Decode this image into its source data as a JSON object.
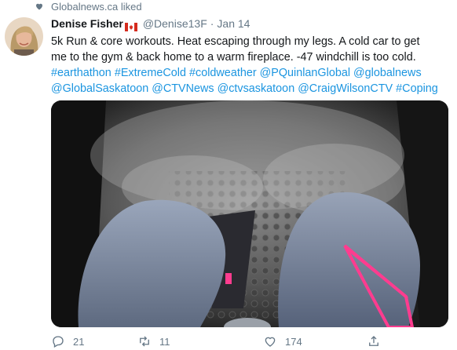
{
  "liked_by": {
    "text": "Globalnews.ca liked"
  },
  "tweet": {
    "display_name": "Denise Fisher",
    "flag_icon": "canada-flag-icon",
    "handle": "@Denise13F",
    "separator": "·",
    "date": "Jan 14",
    "text_line1": "5k Run & core workouts. Heat escaping through my legs. A cold car to get",
    "text_line2": "me to the gym & back home to a warm fireplace. -47 windchill is too cold.",
    "tags_line3": [
      "#earthathon",
      "#ExtremeCold",
      "#coldweather",
      "@PQuinlanGlobal",
      "@globalnews"
    ],
    "tags_line4": [
      "@GlobalSaskatoon",
      "@CTVNews",
      "@ctvsaskatoon",
      "@CraigWilsonCTV",
      "#Coping"
    ]
  },
  "actions": {
    "replies": "21",
    "retweets": "11",
    "likes": "174"
  },
  "colors": {
    "link": "#1b95e0",
    "secondary": "#657786",
    "accent_pink": "#ff3c8f"
  }
}
